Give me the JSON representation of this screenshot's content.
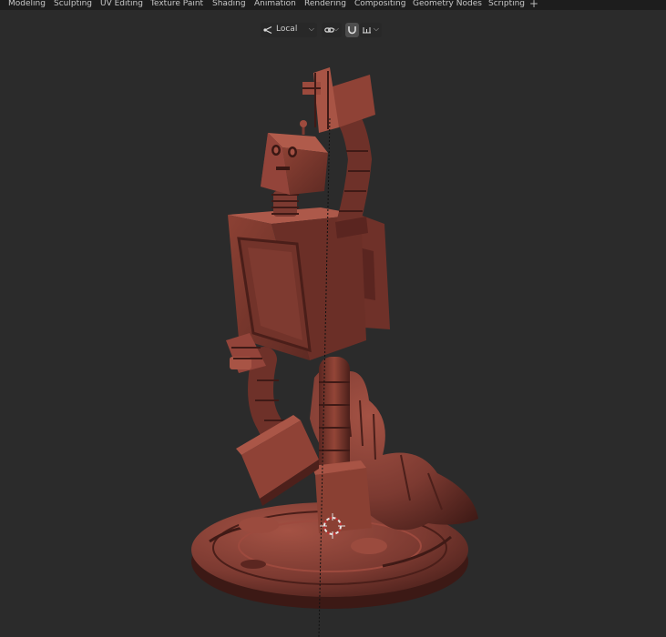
{
  "workspace_tabs": [
    {
      "label": "Modeling"
    },
    {
      "label": "Sculpting"
    },
    {
      "label": "UV Editing"
    },
    {
      "label": "Texture Paint"
    },
    {
      "label": "Shading"
    },
    {
      "label": "Animation"
    },
    {
      "label": "Rendering"
    },
    {
      "label": "Compositing"
    },
    {
      "label": "Geometry Nodes"
    },
    {
      "label": "Scripting"
    }
  ],
  "add_workspace": "+",
  "header": {
    "transform_orientation": {
      "icon": "orientation-axes-icon",
      "value": "Local"
    },
    "pivot": {
      "icon": "link-icon"
    },
    "snap": {
      "icon": "magnet-icon"
    },
    "proportional": {
      "icon": "snap-increment-icon"
    }
  },
  "colors": {
    "topbar": "#1d1d1d",
    "viewport_bg": "#2b2b2b",
    "model": "#7c3a31",
    "model_highlight": "#a45244",
    "model_shadow": "#3f1a16"
  }
}
